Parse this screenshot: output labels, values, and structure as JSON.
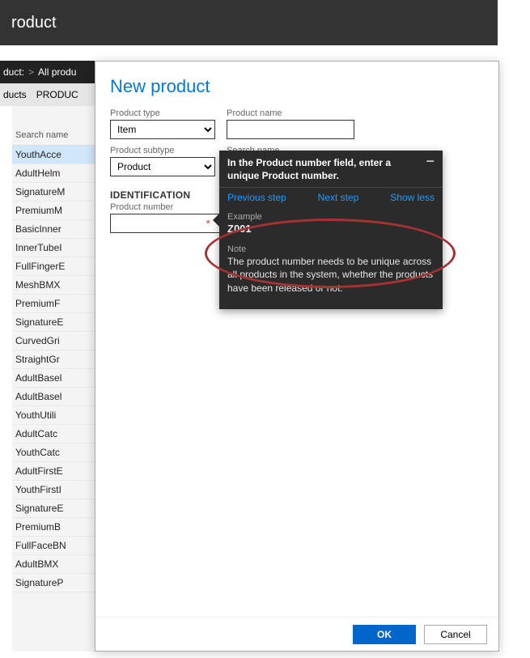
{
  "header": {
    "title_fragment": "roduct"
  },
  "breadcrumb": {
    "seg1": "duct:",
    "sep": ">",
    "seg2": "All produ"
  },
  "subtabs": {
    "t1": "  ducts",
    "t2": "PRODUC"
  },
  "list": {
    "column_header": "Search name",
    "items": [
      "YouthAcce",
      "AdultHelm",
      "SignatureM",
      "PremiumM",
      "BasicInner",
      "InnerTubeI",
      "FullFingerE",
      "MeshBMX",
      "PremiumF",
      "SignatureE",
      "CurvedGri",
      "StraightGr",
      "AdultBasel",
      "AdultBasel",
      "YouthUtili",
      "AdultCatc",
      "YouthCatc",
      "AdultFirstE",
      "YouthFirstI",
      "SignatureE",
      "PremiumB",
      "FullFaceBN",
      "AdultBMX",
      "SignatureP"
    ]
  },
  "form": {
    "title": "New product",
    "labels": {
      "product_type": "Product type",
      "product_name": "Product name",
      "product_subtype": "Product subtype",
      "search_name": "Search name",
      "identification": "IDENTIFICATION",
      "product_number": "Product number"
    },
    "values": {
      "product_type": "Item",
      "product_subtype": "Product",
      "product_name": "",
      "search_name": "",
      "product_number": ""
    },
    "buttons": {
      "ok": "OK",
      "cancel": "Cancel"
    }
  },
  "tooltip": {
    "title": "In the Product number field, enter a unique Product number.",
    "links": {
      "prev": "Previous step",
      "next": "Next step",
      "less": "Show less"
    },
    "example_label": "Example",
    "example_value": "Z001",
    "note_label": "Note",
    "note_text": "The product number needs to be unique across all products in the system, whether the products have been released or not.",
    "collapse": "−"
  }
}
